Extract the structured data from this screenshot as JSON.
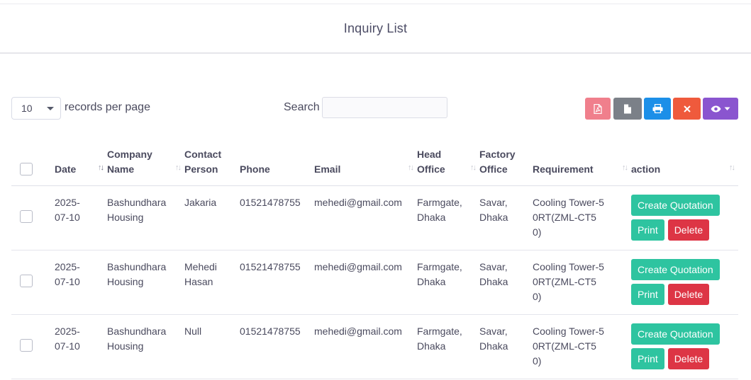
{
  "page": {
    "title": "Inquiry List"
  },
  "controls": {
    "page_length": "10",
    "page_length_label": "records per page",
    "search_label": "Search",
    "search_value": "",
    "export_buttons": [
      {
        "name": "export-pdf-button",
        "icon": "file-pdf-icon"
      },
      {
        "name": "export-csv-button",
        "icon": "file-icon"
      },
      {
        "name": "print-button",
        "icon": "printer-icon"
      },
      {
        "name": "clear-button",
        "icon": "close-icon"
      },
      {
        "name": "column-visibility-button",
        "icon": "eye-icon"
      }
    ]
  },
  "table": {
    "headers": [
      {
        "label": ""
      },
      {
        "label": "Date"
      },
      {
        "label": "Company Name"
      },
      {
        "label": "Contact Person"
      },
      {
        "label": "Phone"
      },
      {
        "label": "Email"
      },
      {
        "label": "Head Office"
      },
      {
        "label": "Factory Office"
      },
      {
        "label": "Requirement"
      },
      {
        "label": "action"
      }
    ],
    "rows": [
      {
        "date": "2025-07-10",
        "company": "Bashundhara Housing",
        "contact": "Jakaria",
        "phone": "01521478755",
        "email": "mehedi@gmail.com",
        "head_office": "Farmgate, Dhaka",
        "factory_office": "Savar, Dhaka",
        "requirement": "Cooling Tower-50RT(ZML-CT50)"
      },
      {
        "date": "2025-07-10",
        "company": "Bashundhara Housing",
        "contact": "Mehedi Hasan",
        "phone": "01521478755",
        "email": "mehedi@gmail.com",
        "head_office": "Farmgate, Dhaka",
        "factory_office": "Savar, Dhaka",
        "requirement": "Cooling Tower-50RT(ZML-CT50)"
      },
      {
        "date": "2025-07-10",
        "company": "Bashundhara Housing",
        "contact": "Null",
        "phone": "01521478755",
        "email": "mehedi@gmail.com",
        "head_office": "Farmgate, Dhaka",
        "factory_office": "Savar, Dhaka",
        "requirement": "Cooling Tower-50RT(ZML-CT50)"
      }
    ],
    "actions": {
      "quote": "Create Quotation",
      "print": "Print",
      "delete": "Delete"
    }
  },
  "colors": {
    "quote": "#2ec4a0",
    "delete": "#dd3545",
    "pdf": "#f07f8c",
    "csv": "#7b8088",
    "print": "#1c8fe8",
    "clear": "#ef5a3c",
    "view": "#8a55cf"
  }
}
